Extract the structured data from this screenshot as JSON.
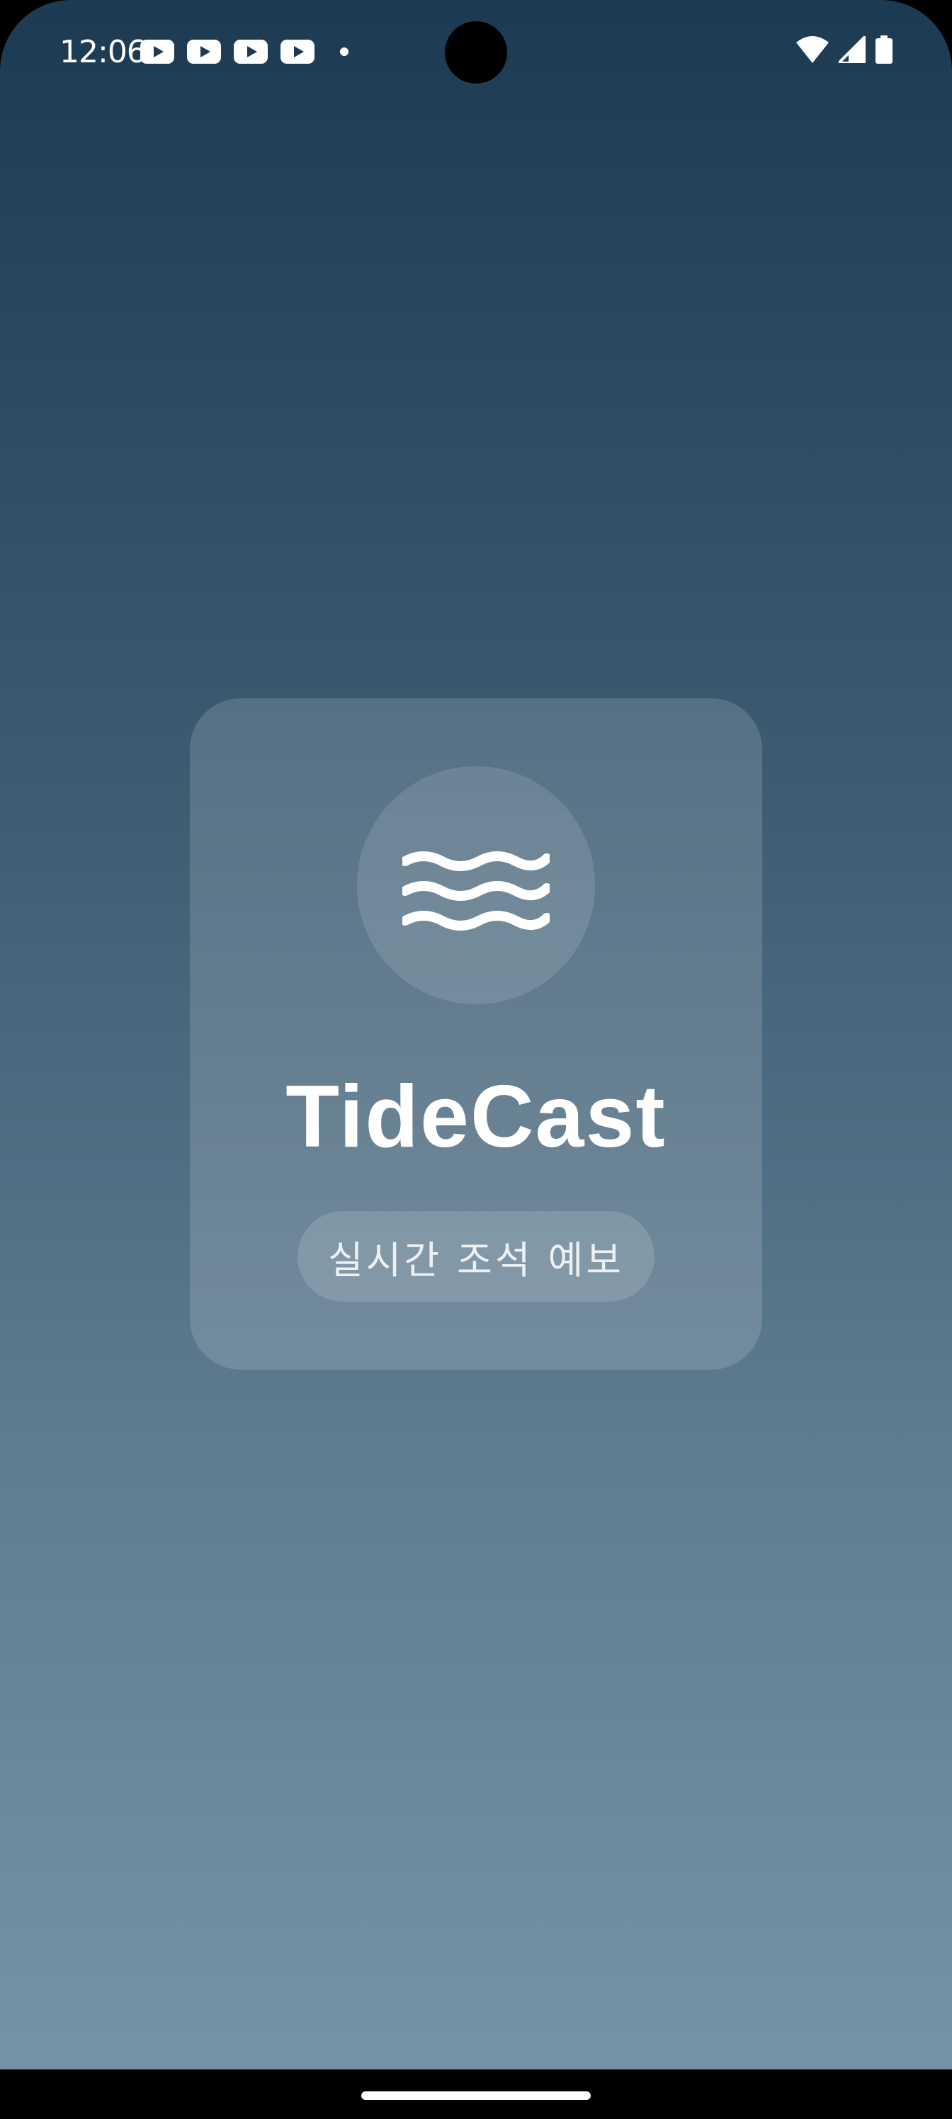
{
  "status_bar": {
    "time": "12:06",
    "notification_icons": [
      "youtube-icon",
      "youtube-icon",
      "youtube-icon",
      "youtube-icon",
      "dot-icon"
    ],
    "system_icons": [
      "wifi-icon",
      "cellular-signal-icon",
      "battery-icon"
    ]
  },
  "splash": {
    "logo_icon": "waves-icon",
    "app_name": "TideCast",
    "tagline": "실시간 조석 예보"
  },
  "colors": {
    "gradient_top": "#1c3a52",
    "gradient_bottom": "#7593a5",
    "text": "#ffffff"
  }
}
